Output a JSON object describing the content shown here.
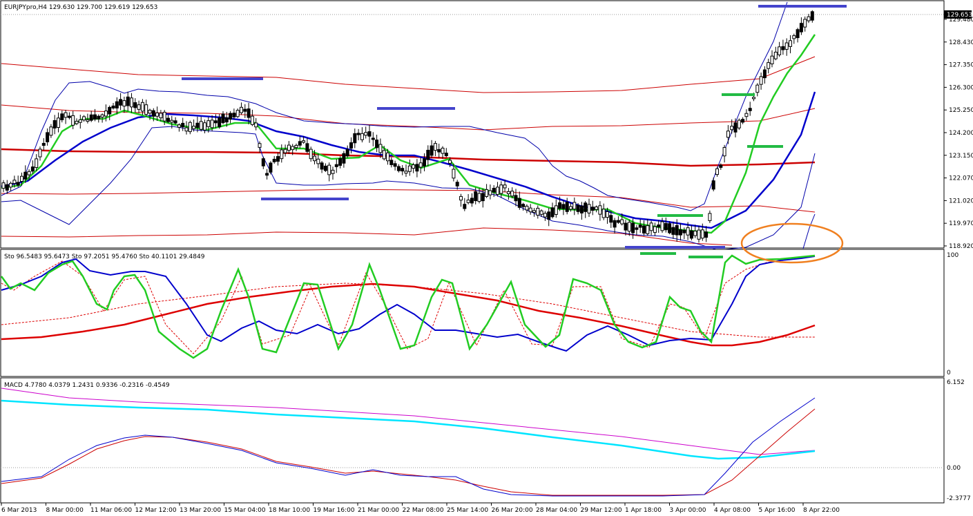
{
  "main_panel": {
    "header": "EURJPYpro,H4  129.630 129.700 129.619 129.653",
    "current_price": "129.653",
    "price_labels": [
      "129.480",
      "128.430",
      "127.350",
      "126.300",
      "125.250",
      "124.200",
      "123.150",
      "122.070",
      "121.020",
      "119.970",
      "118.920"
    ]
  },
  "stoch_panel": {
    "header": "Sto 96.5483 95.6473  Sto 97.2051 95.4760  Sto 40.1101 29.4849",
    "levels": [
      "100",
      "0"
    ]
  },
  "macd_panel": {
    "header": "MACD 4.7780 4.0379 1.2431 0.9336 -0.2316 -0.4549",
    "levels": [
      "6.152",
      "0.00",
      "-2.3777"
    ]
  },
  "time_labels": [
    "6 Mar 2013",
    "8 Mar 00:00",
    "11 Mar 06:00",
    "12 Mar 12:00",
    "13 Mar 20:00",
    "15 Mar 04:00",
    "18 Mar 10:00",
    "19 Mar 16:00",
    "21 Mar 00:00",
    "22 Mar 08:00",
    "25 Mar 14:00",
    "26 Mar 20:00",
    "28 Mar 04:00",
    "29 Mar 12:00",
    "1 Apr 18:00",
    "3 Apr 00:00",
    "4 Apr 08:00",
    "5 Apr 16:00",
    "8 Apr 22:00"
  ],
  "colors": {
    "border": "#000000",
    "grid": "#c0c0c0",
    "candle": "#000000",
    "ma_green": "#22cc22",
    "ma_blue": "#0000cc",
    "bollinger": "#0000aa",
    "envelope": "#cc0000",
    "stoch_red": "#dd0000",
    "macd_cyan": "#00e5ff",
    "macd_magenta": "#cc00cc",
    "annotation_blue": "#4444cc",
    "annotation_green": "#22bb44",
    "annotation_orange": "#f08020"
  }
}
